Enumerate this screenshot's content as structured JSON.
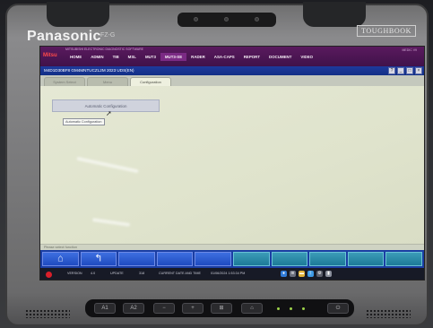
{
  "device": {
    "brand": "Panasonic",
    "model": "FZ-G",
    "badge": "TOUGHBOOK"
  },
  "app": {
    "logo": "Mitsu",
    "header_sub": "MITSUBISHI ELECTRONIC DIAGNOSTIC SOFTWARE",
    "header_right": "MEDIC  V9",
    "menu": [
      {
        "label": "HOME"
      },
      {
        "label": "ADMIN"
      },
      {
        "label": "TIB"
      },
      {
        "label": "MSL"
      },
      {
        "label": "MUT3"
      },
      {
        "label": "MUT3-SE"
      },
      {
        "label": "RADER"
      },
      {
        "label": "ASA-CAPS"
      },
      {
        "label": "REPORT"
      },
      {
        "label": "DOCUMENT"
      },
      {
        "label": "VIDEO"
      }
    ],
    "active_menu_index": 5,
    "window_title": "M4D1D30BF8  GM4MNTUCZL2M 2023  UDS(EN)",
    "window_buttons": [
      "?",
      "_",
      "□",
      "×"
    ],
    "tabs": [
      {
        "label": "System Select",
        "active": false
      },
      {
        "label": "Menu",
        "active": false
      },
      {
        "label": "Configuration",
        "active": true
      }
    ],
    "config_button": "Automatic Configuration",
    "tooltip": "Automatic Configuration",
    "status_text": "Please select function",
    "function_buttons": [
      {
        "icon": "home-icon",
        "glyph": "⌂",
        "style": "blue"
      },
      {
        "icon": "return-arrow-icon",
        "glyph": "↰",
        "style": "blue"
      },
      {
        "icon": "",
        "glyph": "",
        "style": "blue"
      },
      {
        "icon": "",
        "glyph": "",
        "style": "blue"
      },
      {
        "icon": "",
        "glyph": "",
        "style": "blue"
      },
      {
        "icon": "",
        "glyph": "",
        "style": "teal"
      },
      {
        "icon": "",
        "glyph": "",
        "style": "teal"
      },
      {
        "icon": "",
        "glyph": "",
        "style": "teal"
      },
      {
        "icon": "",
        "glyph": "",
        "style": "teal"
      },
      {
        "icon": "",
        "glyph": "",
        "style": "teal"
      }
    ],
    "system_bar": {
      "version_label": "VERSION",
      "version_value": "4.0",
      "update_label": "UPDATE",
      "update_value": "318",
      "datetime_label": "CURRENT DATE AND TIME",
      "datetime_value": "01/06/2024 1:53:34 PM"
    }
  },
  "hardware_buttons": [
    "A1",
    "A2",
    "−",
    "+",
    "⊞",
    "⌂",
    "⏻"
  ],
  "colors": {
    "menubar": "#40124a",
    "titlebar": "#123087",
    "function_blue": "#1f4bc0",
    "function_teal": "#1d7a98"
  }
}
